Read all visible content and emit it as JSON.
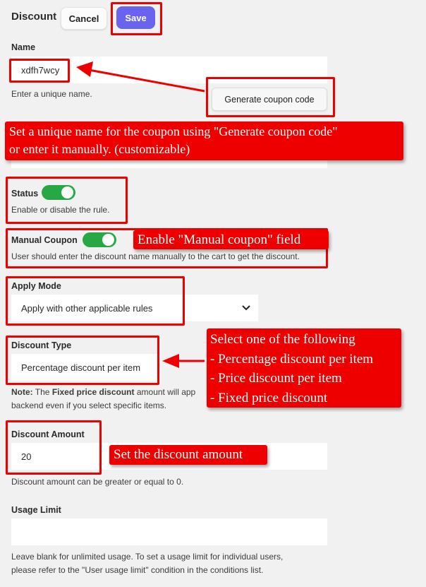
{
  "header": {
    "title": "Discount",
    "cancel_label": "Cancel",
    "save_label": "Save"
  },
  "name_field": {
    "label": "Name",
    "value": "xdfh7wcy",
    "help": "Enter a unique name.",
    "generate_label": "Generate coupon code"
  },
  "status_field": {
    "label": "Status",
    "enabled": true,
    "help": "Enable or disable the rule."
  },
  "manual_coupon_field": {
    "label": "Manual Coupon",
    "enabled": true,
    "help": "User should enter the discount name manually to the cart to get the discount."
  },
  "apply_mode_field": {
    "label": "Apply Mode",
    "selected": "Apply with other applicable rules"
  },
  "discount_type_field": {
    "label": "Discount Type",
    "selected": "Percentage discount per item",
    "note_prefix": "Note:",
    "note_text_1": " The ",
    "note_bold": "Fixed price discount",
    "note_text_2": " amount will app",
    "note_line2": "backend even if you select specific items."
  },
  "discount_amount_field": {
    "label": "Discount Amount",
    "value": "20",
    "help": "Discount amount can be greater or equal to 0."
  },
  "usage_limit_field": {
    "label": "Usage Limit",
    "value": "",
    "help_line1": "Leave blank for unlimited usage. To set a usage limit for individual users,",
    "help_line2": "please refer to the \"User usage limit\" condition in the conditions list."
  },
  "annotations": {
    "name_callout_line1": "Set a unique name for the coupon using \"Generate coupon code\"",
    "name_callout_line2": "or enter it manually. (customizable)",
    "manual_coupon_callout": "Enable \"Manual coupon\" field",
    "discount_type_callout": {
      "title": "Select one of the following",
      "options": [
        "- Percentage discount per item",
        "- Price discount per item",
        "- Fixed price discount"
      ]
    },
    "discount_amount_callout": "Set the discount amount"
  },
  "colors": {
    "accent": "#6a63ee",
    "toggle_on": "#28a745",
    "annotation_red": "#ee0000",
    "background": "#f1f1f1"
  }
}
